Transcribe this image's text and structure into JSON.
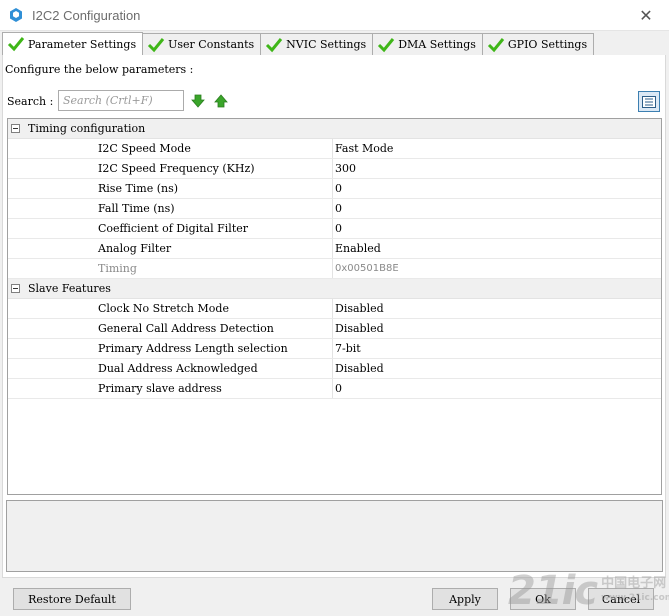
{
  "window": {
    "title": "I2C2 Configuration",
    "close_glyph": "✕"
  },
  "tabs": [
    {
      "label": "Parameter Settings",
      "active": true
    },
    {
      "label": "User Constants",
      "active": false
    },
    {
      "label": "NVIC Settings",
      "active": false
    },
    {
      "label": "DMA Settings",
      "active": false
    },
    {
      "label": "GPIO Settings",
      "active": false
    }
  ],
  "configure_label": "Configure the below parameters :",
  "search": {
    "label": "Search :",
    "placeholder": "Search (Crtl+F)"
  },
  "sections": [
    {
      "title": "Timing configuration",
      "rows": [
        {
          "name": "I2C Speed Mode",
          "value": "Fast Mode"
        },
        {
          "name": "I2C Speed Frequency (KHz)",
          "value": "300"
        },
        {
          "name": "Rise Time (ns)",
          "value": "0"
        },
        {
          "name": "Fall Time (ns)",
          "value": "0"
        },
        {
          "name": "Coefficient of Digital Filter",
          "value": "0"
        },
        {
          "name": "Analog Filter",
          "value": "Enabled"
        },
        {
          "name": "Timing",
          "value": "0x00501B8E"
        }
      ]
    },
    {
      "title": "Slave Features",
      "rows": [
        {
          "name": "Clock No Stretch Mode",
          "value": "Disabled"
        },
        {
          "name": "General Call Address Detection",
          "value": "Disabled"
        },
        {
          "name": "Primary Address Length selection",
          "value": "7-bit"
        },
        {
          "name": "Dual Address Acknowledged",
          "value": "Disabled"
        },
        {
          "name": "Primary slave address",
          "value": "0"
        }
      ]
    }
  ],
  "buttons": {
    "restore_default": "Restore Default",
    "apply": "Apply",
    "ok": "Ok",
    "cancel": "Cancel"
  },
  "watermark": {
    "big": "21ic",
    "line1": "中国电子网",
    "line2": "www.21ic.com"
  },
  "colors": {
    "check_green": "#3fb618",
    "arrow_green": "#3aa52a",
    "app_icon_blue": "#2f8fd6"
  }
}
